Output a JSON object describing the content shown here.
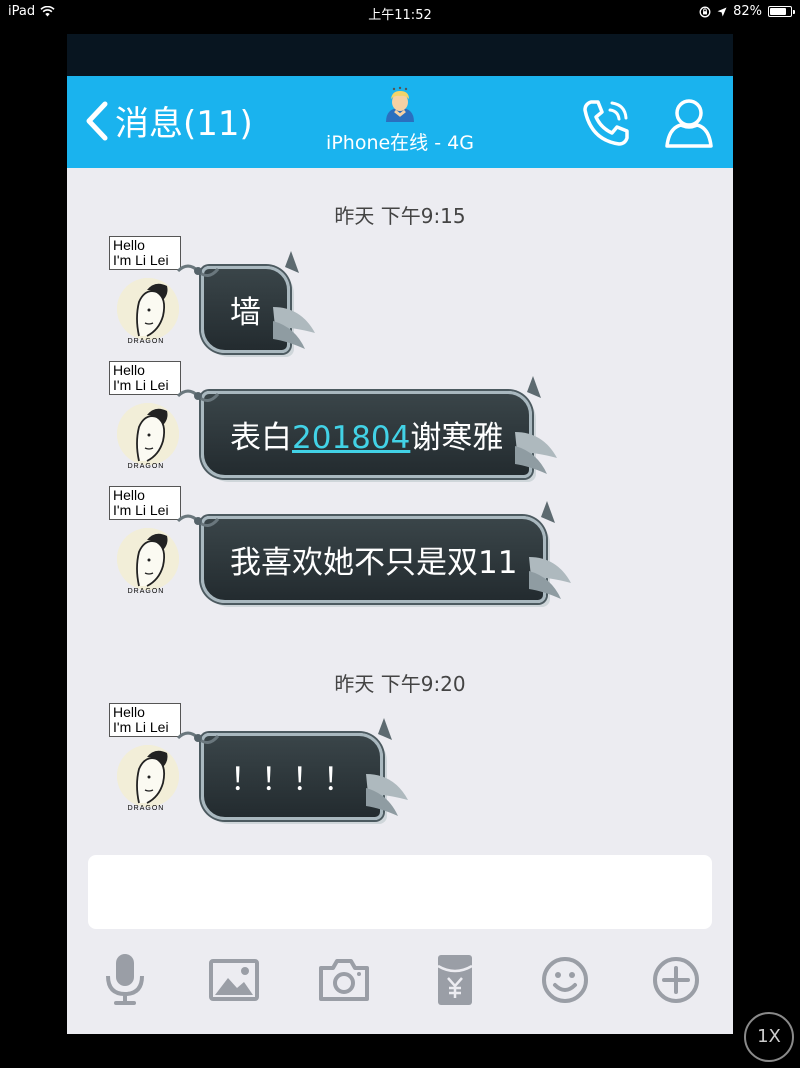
{
  "status_bar": {
    "device": "iPad",
    "time": "上午11:52",
    "battery": "82%",
    "battery_level": 0.82
  },
  "nav": {
    "back_label": "消息(11)",
    "contact_status": "iPhone在线 - 4G"
  },
  "timestamps": [
    "昨天 下午9:15",
    "昨天 下午9:20"
  ],
  "avatar": {
    "sign_line1": "Hello",
    "sign_line2": "I'm Li Lei",
    "badge": "DRAGON"
  },
  "messages": [
    {
      "text": "墙"
    },
    {
      "prefix": "表白",
      "number": "201804",
      "suffix": "谢寒雅"
    },
    {
      "text": "我喜欢她不只是双11"
    },
    {
      "text": "！！！！"
    }
  ],
  "input": {
    "placeholder": ""
  },
  "toolbar": [
    "microphone-icon",
    "image-icon",
    "camera-icon",
    "red-packet-icon",
    "emoji-icon",
    "plus-icon"
  ],
  "zoom_badge": "1X",
  "colors": {
    "nav_blue": "#1ab3ee",
    "chat_bg": "#ececf1",
    "bubble_dark": "#2a3337",
    "link_cyan": "#42d2e6",
    "icon_gray": "#9a9ea6"
  }
}
